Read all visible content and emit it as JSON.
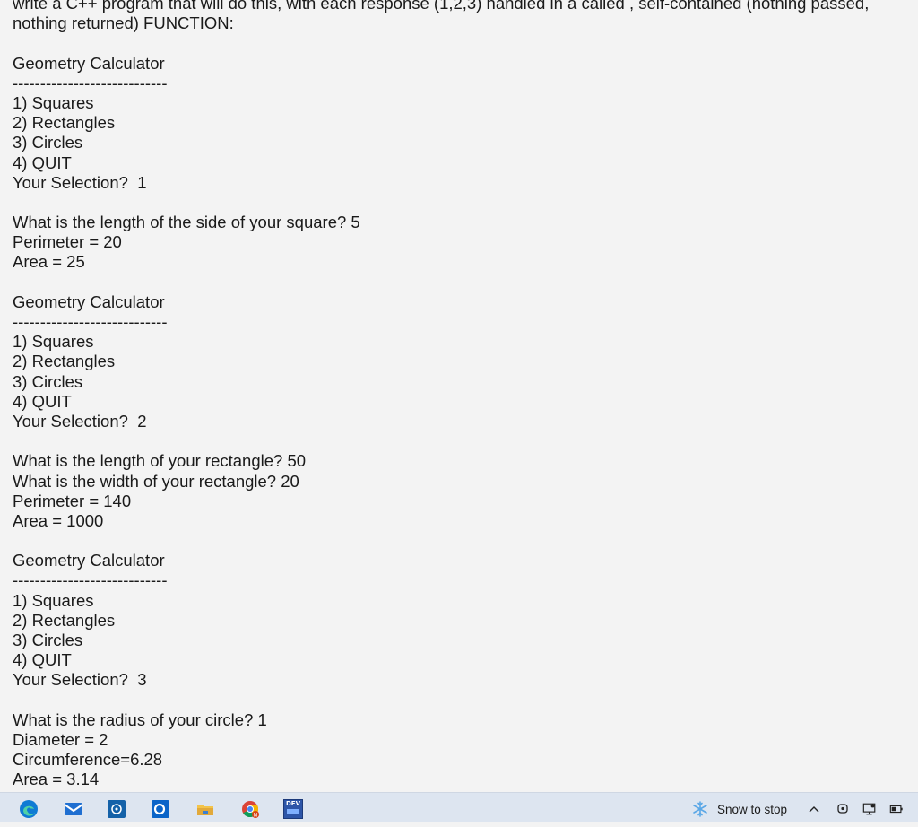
{
  "document": {
    "lines": [
      "write a C++ program that will do this, with each response (1,2,3) handled in a called , self-contained (nothing passed,",
      "nothing returned) FUNCTION:",
      "",
      "Geometry Calculator",
      "----------------------------",
      "1) Squares",
      "2) Rectangles",
      "3) Circles",
      "4) QUIT",
      "Your Selection?  1",
      "",
      "What is the length of the side of your square? 5",
      "Perimeter = 20",
      "Area = 25",
      "",
      "Geometry Calculator",
      "----------------------------",
      "1) Squares",
      "2) Rectangles",
      "3) Circles",
      "4) QUIT",
      "Your Selection?  2",
      "",
      "What is the length of your rectangle? 50",
      "What is the width of your rectangle? 20",
      "Perimeter = 140",
      "Area = 1000",
      "",
      "Geometry Calculator",
      "----------------------------",
      "1) Squares",
      "2) Rectangles",
      "3) Circles",
      "4) QUIT",
      "Your Selection?  3",
      "",
      "What is the radius of your circle? 1",
      "Diameter = 2",
      "Circumference=6.28",
      "Area = 3.14"
    ]
  },
  "taskbar": {
    "pinned_icons": [
      "edge-icon",
      "mail-icon",
      "app-icon",
      "outlook-icon",
      "file-explorer-icon",
      "chrome-icon",
      "devc-icon"
    ],
    "devc_label": "DEV",
    "tray": {
      "weather_text": "Snow to stop",
      "icons": [
        "snowflake-icon",
        "chevron-up-icon",
        "meet-now-icon",
        "network-icon",
        "battery-icon"
      ]
    },
    "colors": {
      "taskbar_bg": "#dde5f0",
      "edge_blue": "#0f7bd4",
      "mail_blue": "#1f6fd1",
      "outlook_blue": "#0a64c8",
      "explorer_yellow": "#f3c44a",
      "devc_blue": "#2d55a8"
    }
  }
}
